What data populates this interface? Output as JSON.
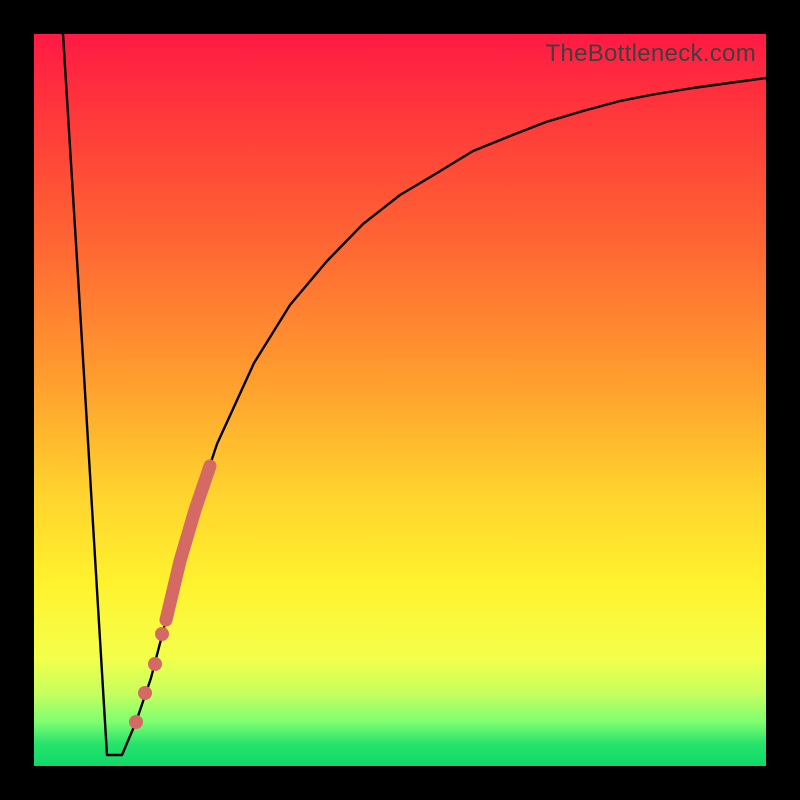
{
  "watermark": "TheBottleneck.com",
  "colors": {
    "frame": "#000000",
    "curve": "#000000",
    "highlight_stroke": "#d46a63",
    "highlight_fill": "#d46a63"
  },
  "chart_data": {
    "type": "line",
    "title": "",
    "xlabel": "",
    "ylabel": "",
    "xlim": [
      0,
      100
    ],
    "ylim": [
      0,
      100
    ],
    "background_gradient": {
      "top_value": 100,
      "bottom_value": 0,
      "meaning": "bottleneck percentage (0 = green/good, 100 = red/bad)"
    },
    "curve": {
      "description": "Bottleneck % as a function of hardware-performance index. Steep drop from the y-axis to a narrow optimum near x≈10, then asymptotic rise toward ~94% as x→100.",
      "x": [
        4,
        6,
        8,
        10,
        12,
        14,
        16,
        18,
        20,
        22,
        25,
        30,
        35,
        40,
        45,
        50,
        55,
        60,
        65,
        70,
        75,
        80,
        85,
        90,
        95,
        100
      ],
      "y": [
        100,
        67,
        34,
        1.5,
        1.5,
        6,
        12,
        20,
        28,
        35,
        44,
        55,
        63,
        69,
        74,
        78,
        81,
        84,
        86,
        88,
        89.5,
        90.8,
        91.8,
        92.6,
        93.3,
        94
      ]
    },
    "highlights": {
      "description": "Emphasised region of recommended alternatives on the right branch of the curve.",
      "segment": {
        "x_start": 18,
        "x_end": 24,
        "note": "thick pink stroke"
      },
      "dots": [
        {
          "x": 14.0,
          "y": 6
        },
        {
          "x": 15.2,
          "y": 10
        },
        {
          "x": 16.5,
          "y": 14
        },
        {
          "x": 17.5,
          "y": 18
        }
      ]
    }
  }
}
